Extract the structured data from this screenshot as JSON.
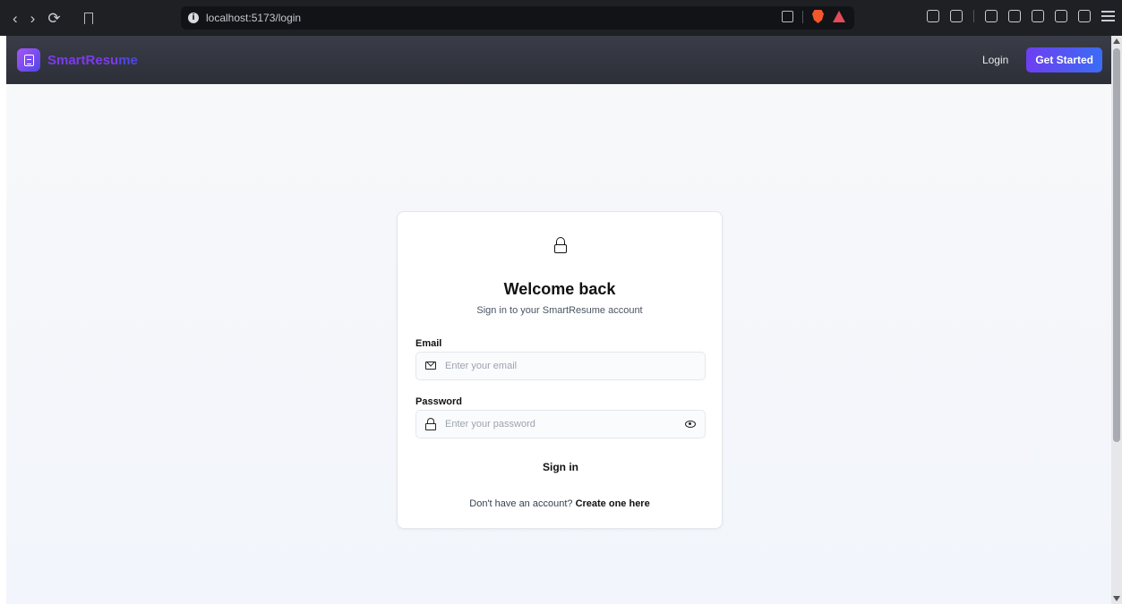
{
  "browser": {
    "url": "localhost:5173/login",
    "back_glyph": "‹",
    "forward_glyph": "›",
    "reload_glyph": "⟳",
    "info_glyph": "i"
  },
  "header": {
    "brand_part1": "SmartResu",
    "brand_part2": "me",
    "login_label": "Login",
    "get_started_label": "Get Started",
    "colors": {
      "brand": "#7c3aed",
      "accent": "#4f46e5"
    }
  },
  "login_card": {
    "title": "Welcome back",
    "subtitle": "Sign in to your SmartResume account",
    "email_label": "Email",
    "email_placeholder": "Enter your email",
    "email_value": "",
    "password_label": "Password",
    "password_placeholder": "Enter your password",
    "password_value": "",
    "submit_label": "Sign in",
    "footer_prompt": "Don't have an account? ",
    "footer_link": "Create one here"
  },
  "icons": {
    "top": "lock-icon",
    "email": "mail-icon",
    "password": "lock-icon",
    "password_toggle": "eye-icon",
    "logo": "document-icon"
  }
}
